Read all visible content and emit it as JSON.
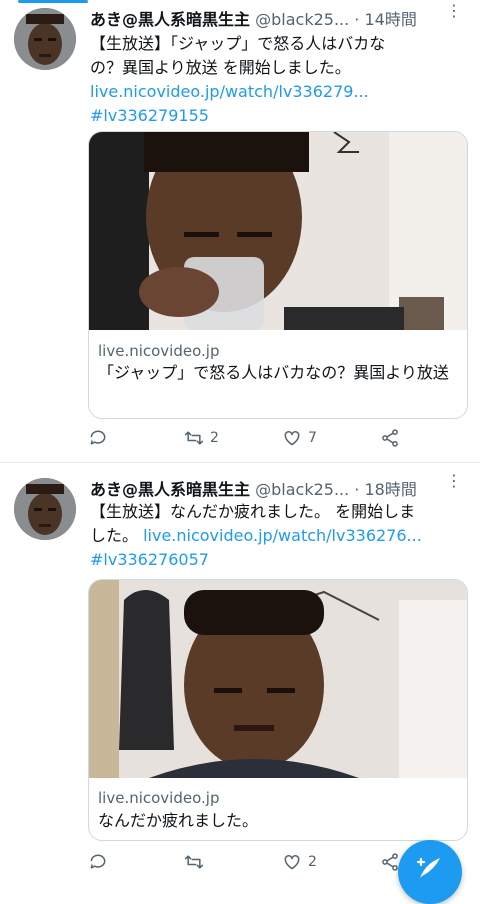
{
  "tweets": [
    {
      "author": {
        "name": "あき@黒人系暗黒生主",
        "handle": "@black25...",
        "time": "14時間"
      },
      "text": {
        "line1": "【生放送】「ジャップ」で怒る人はバカな",
        "line2": "の？異国より放送 を開始しました。",
        "link": "live.nicovideo.jp/watch/lv336279...",
        "hashtag": "#lv336279155"
      },
      "card": {
        "domain": "live.nicovideo.jp",
        "title": "「ジャップ」で怒る人はバカなの？異国より放送"
      },
      "stats": {
        "replies": "",
        "retweets": "2",
        "likes": "7"
      }
    },
    {
      "author": {
        "name": "あき@黒人系暗黒生主",
        "handle": "@black25...",
        "time": "18時間"
      },
      "text": {
        "line1": "【生放送】なんだか疲れました。 を開始しま",
        "line2_prefix": "した。 ",
        "link": "live.nicovideo.jp/watch/lv336276...",
        "hashtag": "#lv336276057"
      },
      "card": {
        "domain": "live.nicovideo.jp",
        "title": "なんだか疲れました。"
      },
      "stats": {
        "replies": "",
        "retweets": "",
        "likes": "2"
      }
    }
  ],
  "icons": {
    "more": "more-dots-icon",
    "reply": "reply-icon",
    "retweet": "retweet-icon",
    "like": "heart-icon",
    "share": "share-icon",
    "compose": "compose-quill-icon"
  },
  "colors": {
    "accent": "#1d9bf0",
    "text": "#0f1419",
    "muted": "#536471",
    "border": "#cfd9de"
  }
}
